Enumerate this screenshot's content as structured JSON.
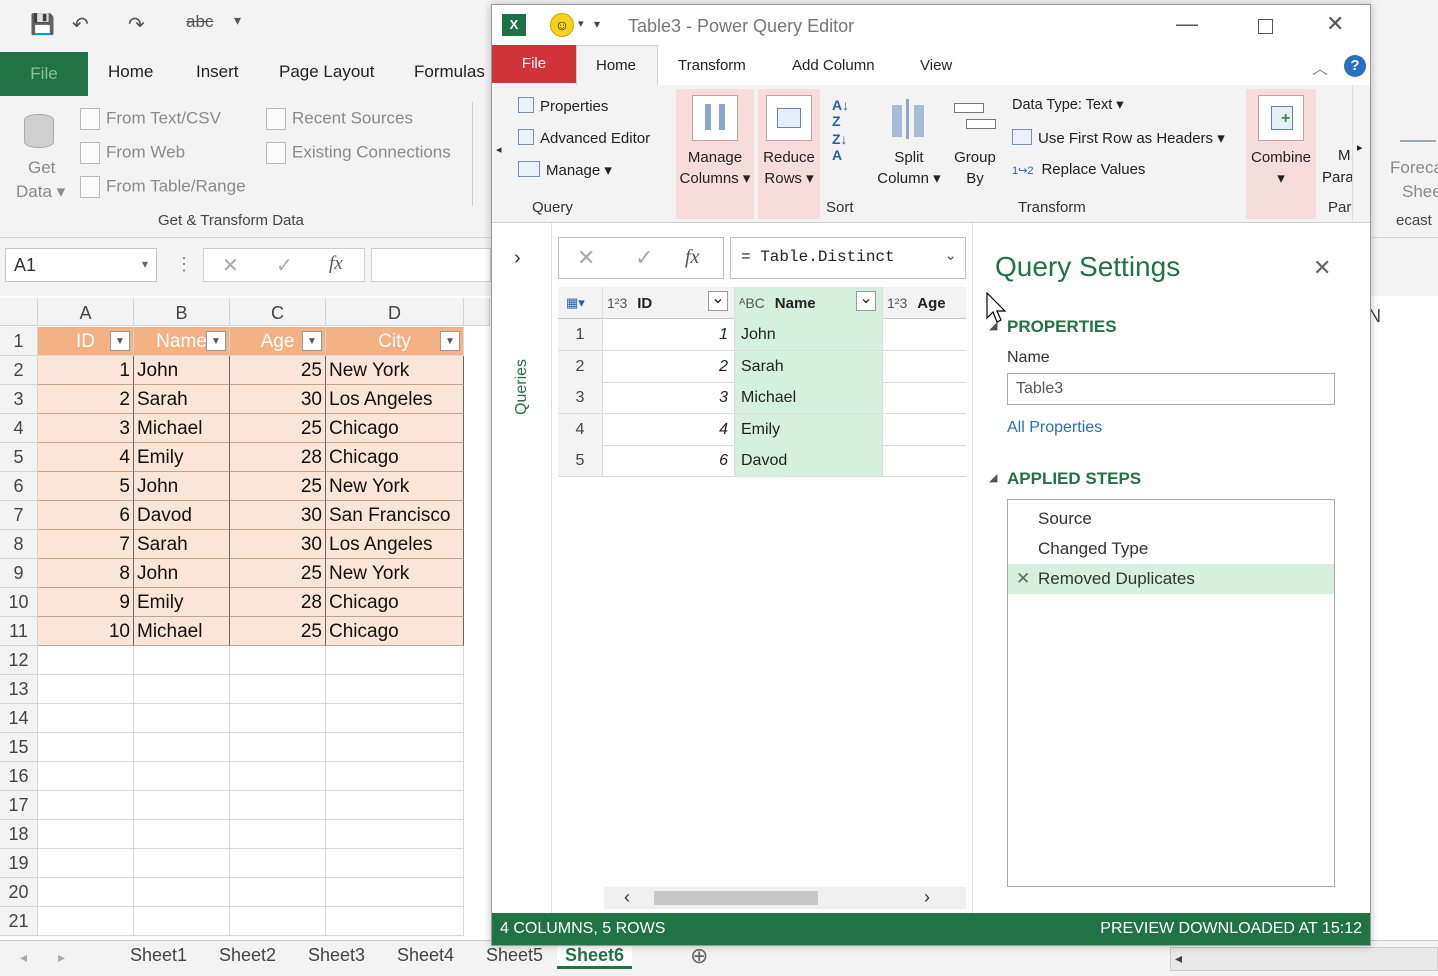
{
  "excel": {
    "qat": {
      "save": "💾",
      "undo": "↶",
      "redo": "↷",
      "spell": "abc",
      "more": "▾"
    },
    "tabs": {
      "file": "File",
      "home": "Home",
      "insert": "Insert",
      "page_layout": "Page Layout",
      "formulas": "Formulas"
    },
    "ribbon": {
      "get_data_1": "Get",
      "get_data_2": "Data ▾",
      "from_text": "From Text/CSV",
      "from_web": "From Web",
      "from_table": "From Table/Range",
      "recent": "Recent Sources",
      "existing": "Existing Connections",
      "group": "Get & Transform Data",
      "forecast": "Foreca",
      "forecast2": "Shee",
      "forecast_group": "ecast"
    },
    "namebox": "A1",
    "fx": "fx",
    "col_headers": [
      "A",
      "B",
      "C",
      "D"
    ],
    "extra_col": "N",
    "row_numbers": [
      "1",
      "2",
      "3",
      "4",
      "5",
      "6",
      "7",
      "8",
      "9",
      "10",
      "11",
      "12",
      "13",
      "14",
      "15",
      "16",
      "17",
      "18",
      "19",
      "20",
      "21"
    ],
    "table_headers": [
      "ID",
      "Name",
      "Age",
      "City"
    ],
    "rows": [
      [
        "1",
        "John",
        "25",
        "New York"
      ],
      [
        "2",
        "Sarah",
        "30",
        "Los Angeles"
      ],
      [
        "3",
        "Michael",
        "25",
        "Chicago"
      ],
      [
        "4",
        "Emily",
        "28",
        "Chicago"
      ],
      [
        "5",
        "John",
        "25",
        "New York"
      ],
      [
        "6",
        "Davod",
        "30",
        "San Francisco"
      ],
      [
        "7",
        "Sarah",
        "30",
        "Los Angeles"
      ],
      [
        "8",
        "John",
        "25",
        "New York"
      ],
      [
        "9",
        "Emily",
        "28",
        "Chicago"
      ],
      [
        "10",
        "Michael",
        "25",
        "Chicago"
      ]
    ],
    "sheets": [
      "Sheet1",
      "Sheet2",
      "Sheet3",
      "Sheet4",
      "Sheet5",
      "Sheet6"
    ],
    "active_sheet": "Sheet6"
  },
  "pq": {
    "title": "Table3 - Power Query Editor",
    "tabs": {
      "file": "File",
      "home": "Home",
      "transform": "Transform",
      "add_column": "Add Column",
      "view": "View"
    },
    "ribbon": {
      "properties": "Properties",
      "advanced_editor": "Advanced Editor",
      "manage": "Manage ▾",
      "query_group": "Query",
      "manage_columns_1": "Manage",
      "manage_columns_2": "Columns ▾",
      "reduce_rows_1": "Reduce",
      "reduce_rows_2": "Rows ▾",
      "sort_group": "Sort",
      "split_1": "Split",
      "split_2": "Column ▾",
      "group_1": "Group",
      "group_2": "By",
      "data_type": "Data Type: Text ▾",
      "first_row": "Use First Row as Headers ▾",
      "replace": "Replace Values",
      "transform_group": "Transform",
      "combine": "Combine",
      "combine_arrow": "▾",
      "m1": "M",
      "m2": "Para",
      "m3": "Par"
    },
    "queries_label": "Queries",
    "formula": "= Table.Distinct",
    "columns": [
      {
        "type": "1²3",
        "name": "ID"
      },
      {
        "type": "ᴬBC",
        "name": "Name"
      },
      {
        "type": "1²3",
        "name": "Age"
      }
    ],
    "rows": [
      [
        "1",
        "1",
        "John"
      ],
      [
        "2",
        "2",
        "Sarah"
      ],
      [
        "3",
        "3",
        "Michael"
      ],
      [
        "4",
        "4",
        "Emily"
      ],
      [
        "5",
        "6",
        "Davod"
      ]
    ],
    "settings": {
      "title": "Query Settings",
      "properties_header": "PROPERTIES",
      "name_label": "Name",
      "name_value": "Table3",
      "all_properties": "All Properties",
      "steps_header": "APPLIED STEPS",
      "steps": [
        "Source",
        "Changed Type",
        "Removed Duplicates"
      ]
    },
    "status_left": "4 COLUMNS, 5 ROWS",
    "status_right": "PREVIEW DOWNLOADED AT 15:12"
  },
  "colors": {
    "excel_green": "#217346",
    "table_header": "#f4b183",
    "table_row": "#fbe5d6",
    "pq_file_red": "#d13438",
    "step_selected": "#d6f0de",
    "accent_green": "#217346"
  }
}
